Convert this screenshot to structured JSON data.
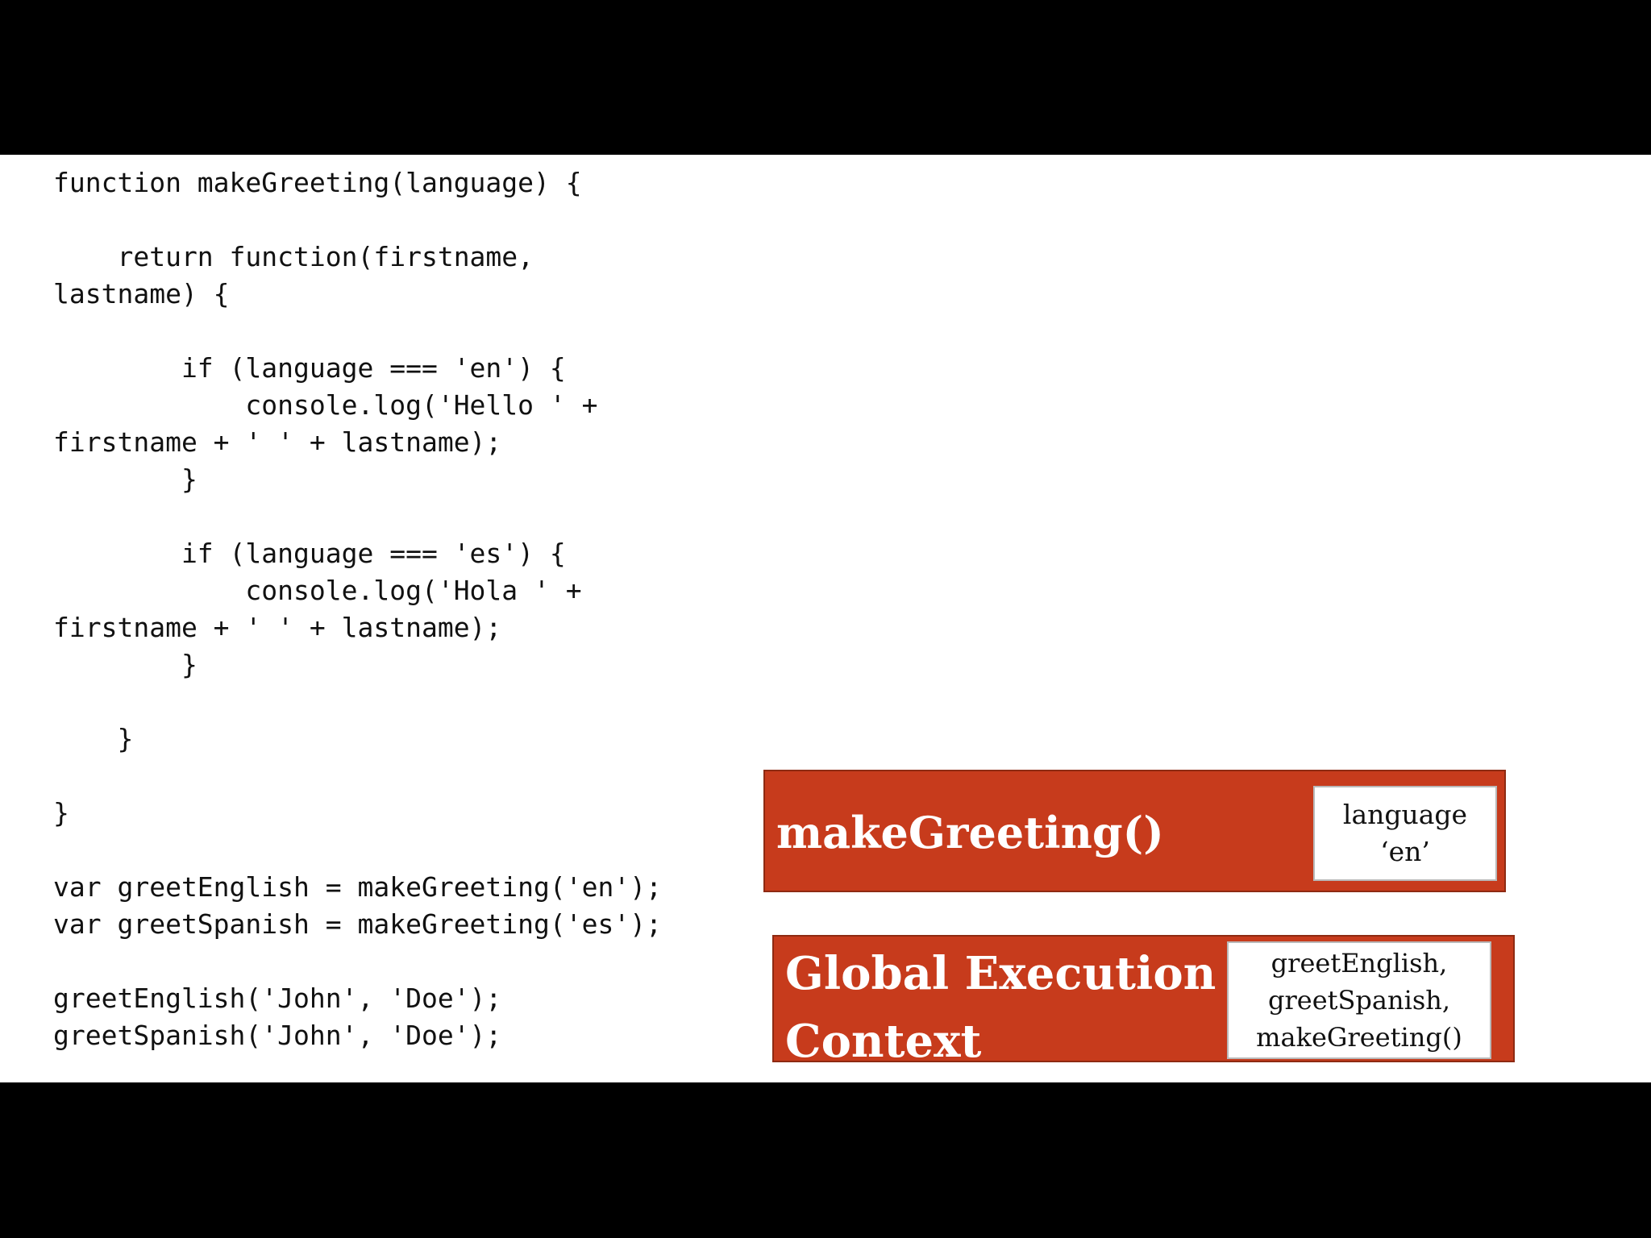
{
  "code": {
    "lines": [
      "function makeGreeting(language) {",
      "",
      "    return function(firstname,",
      "lastname) {",
      "",
      "        if (language === 'en') {",
      "            console.log('Hello ' +",
      "firstname + ' ' + lastname);",
      "        }",
      "",
      "        if (language === 'es') {",
      "            console.log('Hola ' +",
      "firstname + ' ' + lastname);",
      "        }",
      "",
      "    }",
      "",
      "}",
      "",
      "var greetEnglish = makeGreeting('en');",
      "var greetSpanish = makeGreeting('es');",
      "",
      "greetEnglish('John', 'Doe');",
      "greetSpanish('John', 'Doe');"
    ]
  },
  "contexts": {
    "make_greeting": {
      "title": "makeGreeting()",
      "variables": [
        "language",
        "‘en’"
      ]
    },
    "global": {
      "title_line1": "Global Execution",
      "title_line2": "Context",
      "variables": [
        "greetEnglish,",
        "greetSpanish,",
        "makeGreeting()"
      ]
    }
  },
  "colors": {
    "context_fill": "#c73b1c",
    "background": "#ffffff",
    "letterbox": "#000000"
  }
}
